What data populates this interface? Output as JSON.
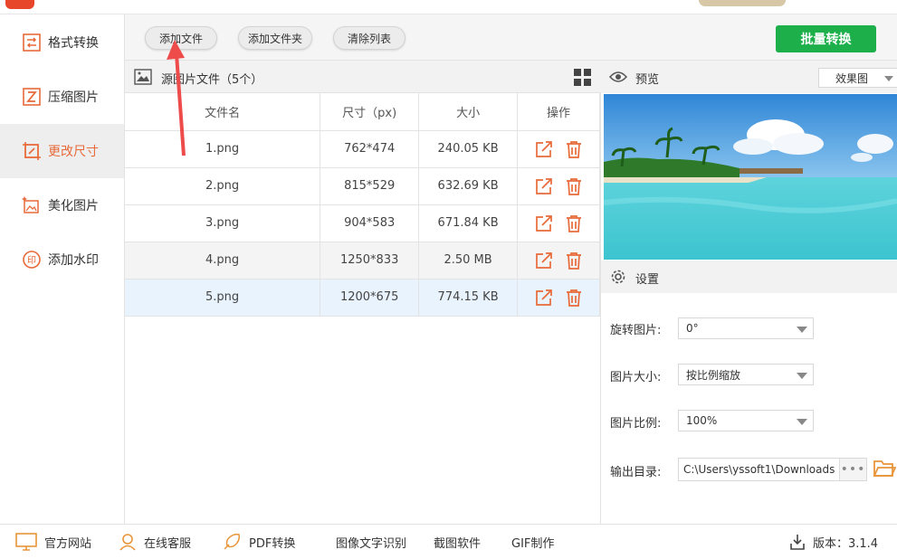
{
  "sidebar": {
    "items": [
      {
        "label": "格式转换",
        "icon": "format-convert-icon"
      },
      {
        "label": "压缩图片",
        "icon": "compress-icon"
      },
      {
        "label": "更改尺寸",
        "icon": "resize-icon",
        "active": true
      },
      {
        "label": "美化图片",
        "icon": "beautify-icon"
      },
      {
        "label": "添加水印",
        "icon": "watermark-icon"
      }
    ]
  },
  "toolbar": {
    "add_file": "添加文件",
    "add_folder": "添加文件夹",
    "clear_list": "清除列表",
    "batch_convert": "批量转换"
  },
  "file_panel": {
    "title": "源图片文件（5个）",
    "columns": [
      "文件名",
      "尺寸（px)",
      "大小",
      "操作"
    ],
    "rows": [
      {
        "name": "1.png",
        "dims": "762*474",
        "size": "240.05 KB"
      },
      {
        "name": "2.png",
        "dims": "815*529",
        "size": "632.69 KB"
      },
      {
        "name": "3.png",
        "dims": "904*583",
        "size": "671.84 KB"
      },
      {
        "name": "4.png",
        "dims": "1250*833",
        "size": "2.50 MB"
      },
      {
        "name": "5.png",
        "dims": "1200*675",
        "size": "774.15 KB"
      }
    ]
  },
  "preview": {
    "title": "预览",
    "mode": "效果图"
  },
  "settings": {
    "title": "设置",
    "rotate_label": "旋转图片:",
    "rotate_value": "0°",
    "size_label": "图片大小:",
    "size_value": "按比例缩放",
    "ratio_label": "图片比例:",
    "ratio_value": "100%",
    "output_label": "输出目录:",
    "output_value": "C:\\Users\\yssoft1\\Downloads"
  },
  "bottom": {
    "website": "官方网站",
    "service": "在线客服",
    "pdf": "PDF转换",
    "ocr": "图像文字识别",
    "screenshot": "截图软件",
    "gif": "GIF制作",
    "version": "版本：3.1.4"
  },
  "colors": {
    "accent": "#e86a3a",
    "green": "#1db04a",
    "selected_row": "#e8f3fd",
    "arrow": "#ee4b4b"
  }
}
